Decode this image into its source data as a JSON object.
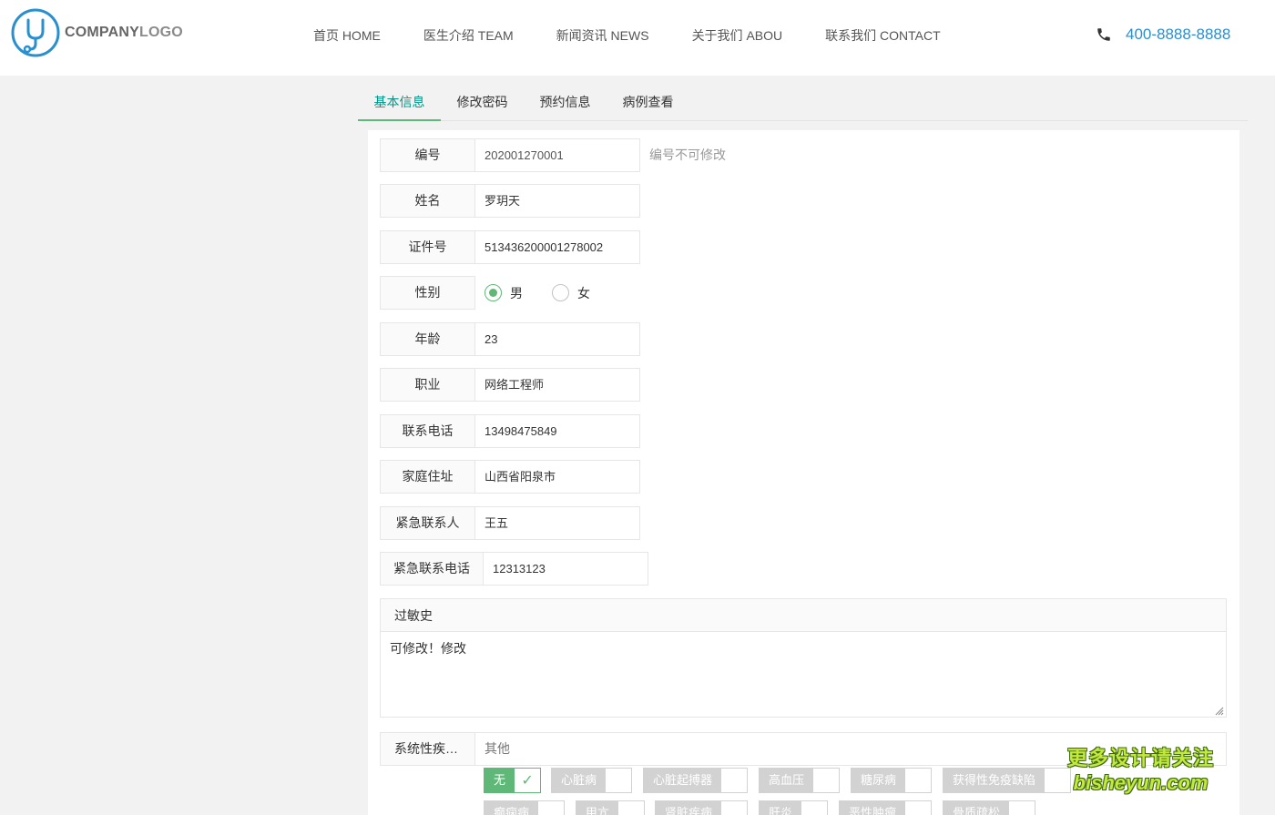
{
  "header": {
    "logo_bold": "COMPANY",
    "logo_light": "LOGO",
    "nav": [
      "首页 HOME",
      "医生介绍 TEAM",
      "新闻资讯 NEWS",
      "关于我们 ABOU",
      "联系我们 CONTACT"
    ],
    "phone": "400-8888-8888",
    "accent_color": "#2a8fcf"
  },
  "tabs": [
    {
      "label": "基本信息",
      "active": true
    },
    {
      "label": "修改密码",
      "active": false
    },
    {
      "label": "预约信息",
      "active": false
    },
    {
      "label": "病例查看",
      "active": false
    }
  ],
  "form": {
    "id": {
      "label": "编号",
      "value": "202001270001",
      "hint": "编号不可修改"
    },
    "name": {
      "label": "姓名",
      "value": "罗玥天"
    },
    "id_card": {
      "label": "证件号",
      "value": "513436200001278002"
    },
    "gender": {
      "label": "性别",
      "options": [
        "男",
        "女"
      ],
      "selected": "男"
    },
    "age": {
      "label": "年龄",
      "value": "23"
    },
    "job": {
      "label": "职业",
      "value": "网络工程师"
    },
    "phone": {
      "label": "联系电话",
      "value": "13498475849"
    },
    "address": {
      "label": "家庭住址",
      "value": "山西省阳泉市"
    },
    "emergency_contact": {
      "label": "紧急联系人",
      "value": "王五"
    },
    "emergency_phone": {
      "label": "紧急联系电话",
      "value": "12313123"
    }
  },
  "allergy": {
    "title": "过敏史",
    "text": "可修改！修改"
  },
  "systemic": {
    "label": "系统性疾…",
    "other_placeholder": "其他",
    "options": [
      {
        "label": "无",
        "checked": true
      },
      {
        "label": "心脏病",
        "checked": false
      },
      {
        "label": "心脏起搏器",
        "checked": false
      },
      {
        "label": "高血压",
        "checked": false
      },
      {
        "label": "糖尿病",
        "checked": false
      },
      {
        "label": "获得性免疫缺陷",
        "checked": false
      },
      {
        "label": "癫痫病",
        "checked": false
      },
      {
        "label": "甲亢",
        "checked": false
      },
      {
        "label": "肾脏疾病",
        "checked": false
      },
      {
        "label": "肝炎",
        "checked": false
      },
      {
        "label": "恶性肿瘤",
        "checked": false
      },
      {
        "label": "骨质疏松",
        "checked": false
      }
    ],
    "check_color": "#5fb878"
  },
  "watermark": {
    "line1": "更多设计请关注",
    "line2": "bisheyun.com"
  }
}
